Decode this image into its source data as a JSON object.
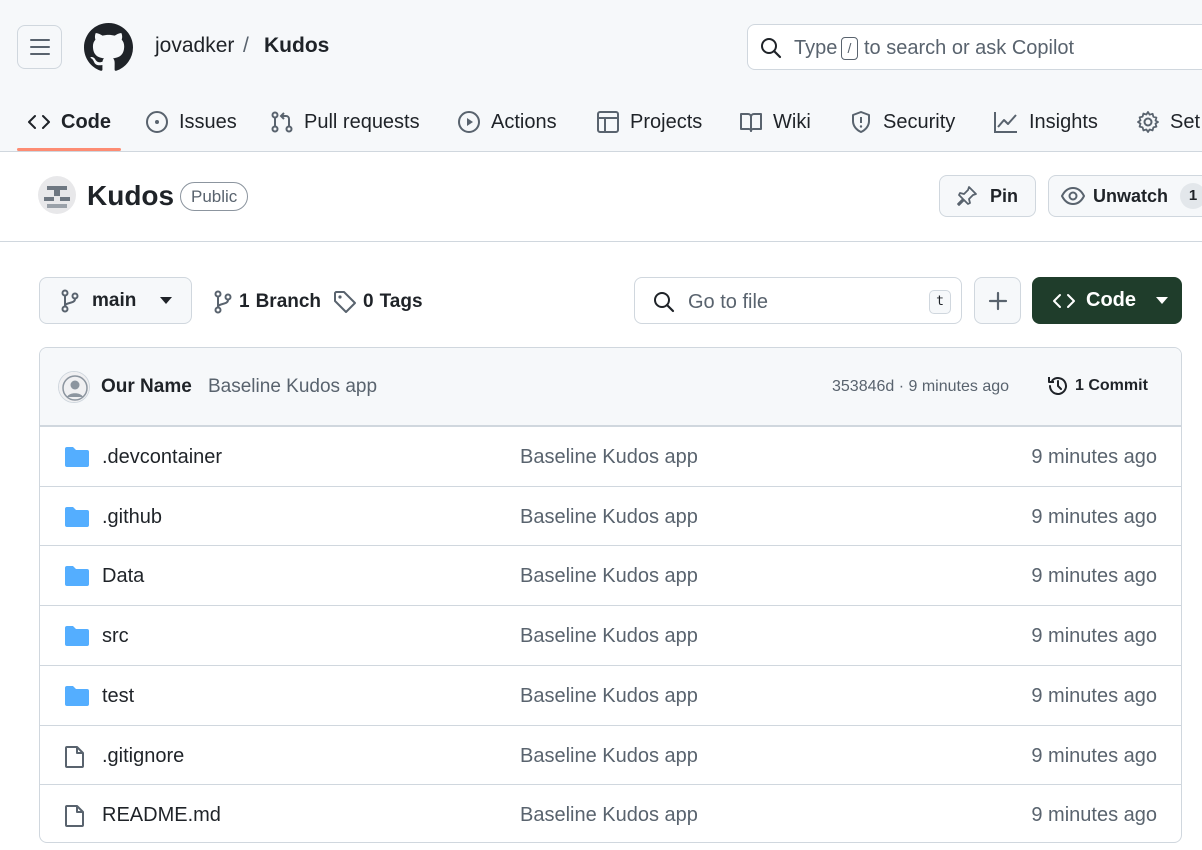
{
  "header": {
    "owner": "jovadker",
    "separator": "/",
    "repo": "Kudos",
    "search": {
      "prefix": "Type",
      "shortcut": "/",
      "suffix": "to search or ask Copilot"
    }
  },
  "tabs": [
    {
      "label": "Code",
      "icon": "code-icon",
      "active": true
    },
    {
      "label": "Issues",
      "icon": "issue-icon"
    },
    {
      "label": "Pull requests",
      "icon": "pull-request-icon"
    },
    {
      "label": "Actions",
      "icon": "play-icon"
    },
    {
      "label": "Projects",
      "icon": "table-icon"
    },
    {
      "label": "Wiki",
      "icon": "book-icon"
    },
    {
      "label": "Security",
      "icon": "shield-icon"
    },
    {
      "label": "Insights",
      "icon": "graph-icon"
    },
    {
      "label": "Set",
      "icon": "gear-icon"
    }
  ],
  "repo": {
    "name": "Kudos",
    "visibility": "Public",
    "pin_label": "Pin",
    "watch_label": "Unwatch",
    "watch_count": "1"
  },
  "toolbar": {
    "branch": "main",
    "branches": {
      "count": "1",
      "label": "Branch"
    },
    "tags": {
      "count": "0",
      "label": "Tags"
    },
    "goto_placeholder": "Go to file",
    "goto_shortcut": "t",
    "code_label": "Code"
  },
  "commit": {
    "author": "Our Name",
    "message": "Baseline Kudos app",
    "meta": "353846d · 9 minutes ago",
    "count_label": "1 Commit"
  },
  "files": [
    {
      "name": ".devcontainer",
      "type": "folder",
      "message": "Baseline Kudos app",
      "age": "9 minutes ago"
    },
    {
      "name": ".github",
      "type": "folder",
      "message": "Baseline Kudos app",
      "age": "9 minutes ago"
    },
    {
      "name": "Data",
      "type": "folder",
      "message": "Baseline Kudos app",
      "age": "9 minutes ago"
    },
    {
      "name": "src",
      "type": "folder",
      "message": "Baseline Kudos app",
      "age": "9 minutes ago"
    },
    {
      "name": "test",
      "type": "folder",
      "message": "Baseline Kudos app",
      "age": "9 minutes ago"
    },
    {
      "name": ".gitignore",
      "type": "file",
      "message": "Baseline Kudos app",
      "age": "9 minutes ago"
    },
    {
      "name": "README.md",
      "type": "file",
      "message": "Baseline Kudos app",
      "age": "9 minutes ago"
    }
  ],
  "colors": {
    "folder": "#54aeff",
    "tab_underline": "#fd8c73",
    "code_button": "#1f3d2b"
  }
}
